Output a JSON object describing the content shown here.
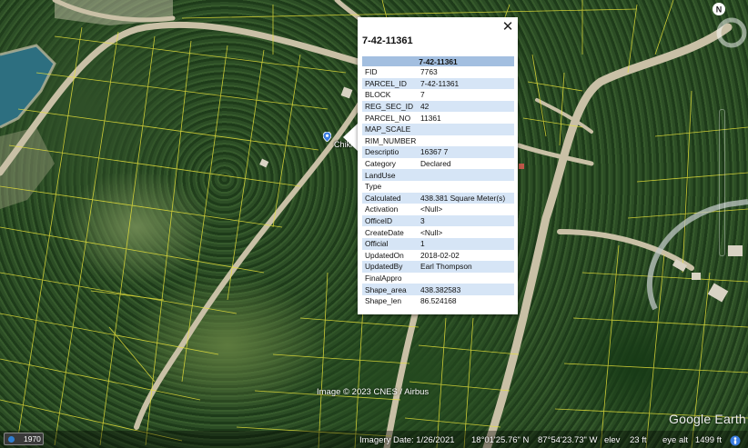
{
  "popup": {
    "title": "7-42-11361",
    "table_header": "7-42-11361",
    "close_glyph": "✕",
    "rows": [
      {
        "key": "FID",
        "value": "7763"
      },
      {
        "key": "PARCEL_ID",
        "value": "7-42-11361"
      },
      {
        "key": "BLOCK",
        "value": "7"
      },
      {
        "key": "REG_SEC_ID",
        "value": "42"
      },
      {
        "key": "PARCEL_NO",
        "value": "11361"
      },
      {
        "key": "MAP_SCALE",
        "value": ""
      },
      {
        "key": "RIM_NUMBER",
        "value": ""
      },
      {
        "key": "Descriptio",
        "value": "16367 7"
      },
      {
        "key": "Category",
        "value": "Declared"
      },
      {
        "key": "LandUse",
        "value": ""
      },
      {
        "key": "Type",
        "value": ""
      },
      {
        "key": "Calculated",
        "value": "438.381 Square Meter(s)"
      },
      {
        "key": "Activation",
        "value": "<Null>"
      },
      {
        "key": "OfficeID",
        "value": "3"
      },
      {
        "key": "CreateDate",
        "value": "<Null>"
      },
      {
        "key": "Official",
        "value": "1"
      },
      {
        "key": "UpdatedOn",
        "value": "2018-02-02"
      },
      {
        "key": "UpdatedBy",
        "value": "Earl Thompson"
      },
      {
        "key": "FinalAppro",
        "value": ""
      },
      {
        "key": "Shape_area",
        "value": "438.382583"
      },
      {
        "key": "Shape_len",
        "value": "86.524168"
      }
    ]
  },
  "map": {
    "place_label": "Chiki",
    "copyright": "Image © 2023 CNES / Airbus",
    "brand": "Google Earth",
    "compass_label": "N"
  },
  "status": {
    "year": "1970",
    "imagery_date": "Imagery Date: 1/26/2021",
    "latitude": "18°01'25.76\" N",
    "longitude": "87°54'23.73\" W",
    "elevation": "elev    23 ft",
    "eye_alt": "eye alt   1499 ft"
  },
  "colors": {
    "parcel_line": "#e8e23a",
    "road": "#c9c0a6",
    "water": "#2d6f80",
    "table_header_bg": "#a3bfe0",
    "table_alt_row_bg": "#d6e5f6"
  },
  "icons": [
    "close-icon",
    "place-pin-icon",
    "compass-icon",
    "navigation-ring-icon",
    "street-view-icon",
    "time-slider-icon"
  ]
}
